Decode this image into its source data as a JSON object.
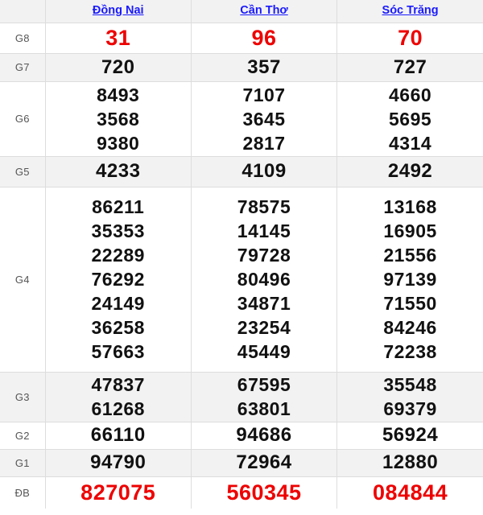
{
  "table": {
    "header": {
      "corner_label": "",
      "provinces": [
        {
          "name": "Đồng Nai",
          "icon": "link-text"
        },
        {
          "name": "Cần Thơ",
          "icon": "link-text"
        },
        {
          "name": "Sóc Trăng",
          "icon": "link-text"
        }
      ]
    },
    "colors": {
      "link_blue": "#1a1aff",
      "highlight_red": "#ee0000",
      "number_black": "#111111",
      "row_shaded": "#f2f2f2",
      "row_plain": "#ffffff",
      "border": "#dddddd",
      "label_gray": "#555555"
    },
    "rows": [
      {
        "label": "G8",
        "shaded": false,
        "style": "red",
        "columns": [
          [
            "31"
          ],
          [
            "96"
          ],
          [
            "70"
          ]
        ]
      },
      {
        "label": "G7",
        "shaded": true,
        "style": "g7",
        "columns": [
          [
            "720"
          ],
          [
            "357"
          ],
          [
            "727"
          ]
        ]
      },
      {
        "label": "G6",
        "shaded": false,
        "style": "normal",
        "columns": [
          [
            "8493",
            "3568",
            "9380"
          ],
          [
            "7107",
            "3645",
            "2817"
          ],
          [
            "4660",
            "5695",
            "4314"
          ]
        ]
      },
      {
        "label": "G5",
        "shaded": true,
        "style": "g5",
        "columns": [
          [
            "4233"
          ],
          [
            "4109"
          ],
          [
            "2492"
          ]
        ]
      },
      {
        "label": "G4",
        "shaded": false,
        "style": "normal",
        "columns": [
          [
            "86211",
            "35353",
            "22289",
            "76292",
            "24149",
            "36258",
            "57663"
          ],
          [
            "78575",
            "14145",
            "79728",
            "80496",
            "34871",
            "23254",
            "45449"
          ],
          [
            "13168",
            "16905",
            "21556",
            "97139",
            "71550",
            "84246",
            "72238"
          ]
        ]
      },
      {
        "label": "G3",
        "shaded": true,
        "style": "normal",
        "columns": [
          [
            "47837",
            "61268"
          ],
          [
            "67595",
            "63801"
          ],
          [
            "35548",
            "69379"
          ]
        ]
      },
      {
        "label": "G2",
        "shaded": false,
        "style": "g2",
        "columns": [
          [
            "66110"
          ],
          [
            "94686"
          ],
          [
            "56924"
          ]
        ]
      },
      {
        "label": "G1",
        "shaded": true,
        "style": "g1",
        "columns": [
          [
            "94790"
          ],
          [
            "72964"
          ],
          [
            "12880"
          ]
        ]
      },
      {
        "label": "ĐB",
        "shaded": false,
        "style": "big-red",
        "columns": [
          [
            "827075"
          ],
          [
            "560345"
          ],
          [
            "084844"
          ]
        ]
      }
    ]
  }
}
